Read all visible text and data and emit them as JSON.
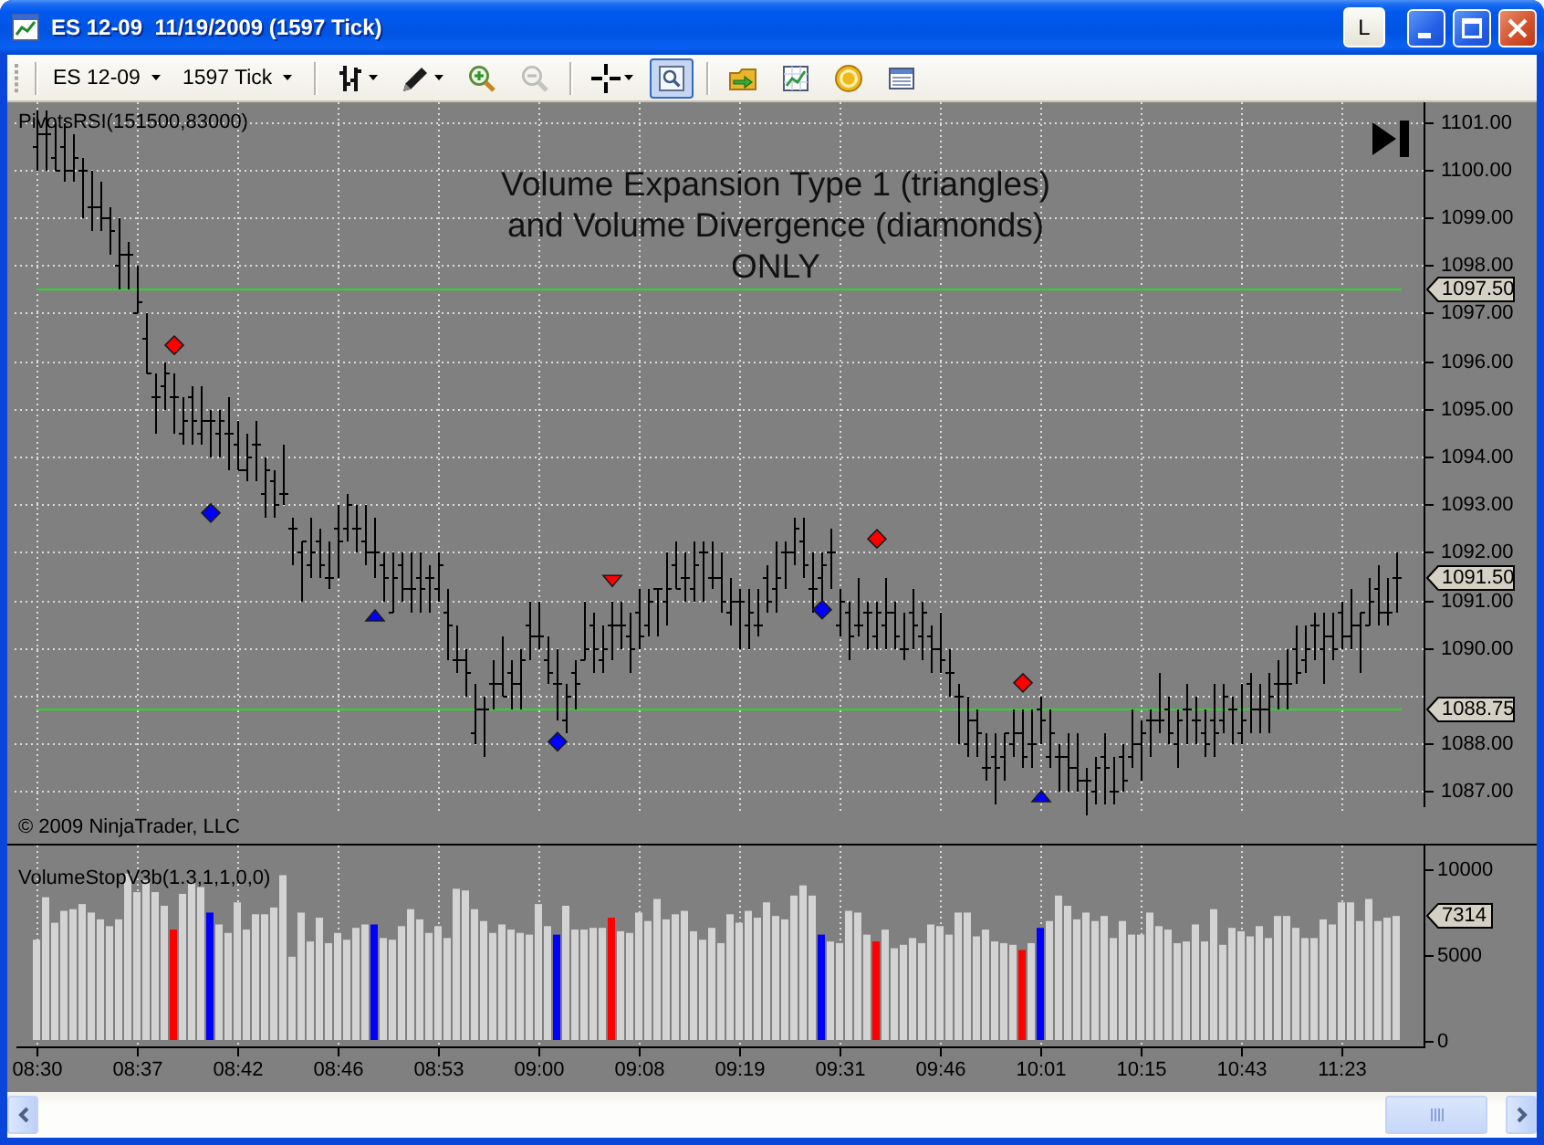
{
  "window": {
    "title": "ES 12-09  11/19/2009 (1597 Tick)",
    "layout_button": "L"
  },
  "toolbar": {
    "instrument": "ES 12-09",
    "interval": "1597 Tick",
    "tool_groups": [
      [
        {
          "kind": "price-bars",
          "dropdown": true,
          "disabled": false,
          "selected": false
        },
        {
          "kind": "pencil",
          "dropdown": true,
          "disabled": false,
          "selected": false
        },
        {
          "kind": "zoom-in",
          "dropdown": false,
          "disabled": false,
          "selected": false
        },
        {
          "kind": "zoom-out",
          "dropdown": false,
          "disabled": true,
          "selected": false
        }
      ],
      [
        {
          "kind": "crosshair",
          "dropdown": true,
          "disabled": false,
          "selected": false
        },
        {
          "kind": "magnifier-frame",
          "dropdown": false,
          "disabled": false,
          "selected": true
        }
      ],
      [
        {
          "kind": "folder-arrow",
          "dropdown": false,
          "disabled": false,
          "selected": false
        },
        {
          "kind": "line-chart",
          "dropdown": false,
          "disabled": false,
          "selected": false
        },
        {
          "kind": "coin",
          "dropdown": false,
          "disabled": false,
          "selected": false
        },
        {
          "kind": "table",
          "dropdown": false,
          "disabled": false,
          "selected": false
        }
      ]
    ]
  },
  "price_panel": {
    "indicator": "PivotsRSI(151500,83000)",
    "note": "Volume Expansion Type 1 (triangles)\nand Volume Divergence (diamonds)\nONLY",
    "y_ticks": [
      "1101.00",
      "1100.00",
      "1099.00",
      "1098.00",
      "1097.00",
      "1096.00",
      "1095.00",
      "1094.00",
      "1093.00",
      "1092.00",
      "1091.00",
      "1090.00",
      "1088.00",
      "1087.00"
    ],
    "price_tags": [
      {
        "label": "1097.50",
        "kind": "level"
      },
      {
        "label": "1091.50",
        "kind": "last"
      },
      {
        "label": "1088.75",
        "kind": "level"
      }
    ],
    "copyright": "© 2009 NinjaTrader, LLC"
  },
  "volume_panel": {
    "indicator": "VolumeStopV3b(1.3,1,1,0,0)",
    "last_value_tag": "7314",
    "time_labels": [
      "08:30",
      "08:37",
      "08:42",
      "08:46",
      "08:53",
      "09:00",
      "09:08",
      "09:19",
      "09:31",
      "09:46",
      "10:01",
      "10:15",
      "10:43",
      "11:23"
    ],
    "chart_data": {
      "type": "bar",
      "stacked": true,
      "ylim": [
        0,
        11500
      ],
      "yticks": [
        0,
        5000,
        10000
      ],
      "series": [
        {
          "color": "#d3d3d3",
          "values": [
            5900,
            8400,
            6900,
            7600,
            7700,
            8000,
            7500,
            7100,
            6700,
            7100,
            9800,
            8700,
            9400,
            8700,
            7900,
            null,
            8600,
            9300,
            9000,
            null,
            6800,
            6300,
            8100,
            6500,
            7400,
            7400,
            7800,
            9700,
            4900,
            7500,
            5800,
            7200,
            5700,
            6300,
            5900,
            6600,
            6800,
            null,
            6000,
            5900,
            6700,
            7700,
            7100,
            6300,
            6700,
            6000,
            8900,
            8800,
            7700,
            7000,
            6300,
            6800,
            6500,
            6300,
            6200,
            8000,
            6700,
            null,
            7900,
            6500,
            6500,
            6600,
            6600,
            null,
            6400,
            6300,
            7500,
            7000,
            8300,
            7100,
            7400,
            7600,
            6400,
            5900,
            6600,
            5700,
            7400,
            6900,
            7600,
            7200,
            8100,
            7300,
            7100,
            8500,
            9100,
            8500,
            null,
            5800,
            5700,
            7600,
            7500,
            6200,
            null,
            6500,
            5400,
            5600,
            6000,
            5700,
            6800,
            6700,
            6200,
            7500,
            7500,
            6100,
            6500,
            5800,
            5700,
            5600,
            null,
            5700,
            null,
            7000,
            8500,
            7900,
            7100,
            7500,
            7000,
            7300,
            6000,
            7000,
            6200,
            6200,
            7500,
            6700,
            6500,
            5700,
            5800,
            6800,
            5800,
            7700,
            5600,
            6600,
            6400,
            6100,
            6700,
            6000,
            7300,
            7300,
            6600,
            6000,
            6000,
            7100,
            6800,
            8100,
            8100,
            7000,
            8300,
            7000,
            7200,
            7300
          ]
        },
        {
          "color": "#ff0000",
          "values": [
            null,
            null,
            null,
            null,
            null,
            null,
            null,
            null,
            null,
            null,
            null,
            null,
            null,
            null,
            null,
            6500,
            null,
            null,
            null,
            null,
            null,
            null,
            null,
            null,
            null,
            null,
            null,
            null,
            null,
            null,
            null,
            null,
            null,
            null,
            null,
            null,
            null,
            null,
            null,
            null,
            null,
            null,
            null,
            null,
            null,
            null,
            null,
            null,
            null,
            null,
            null,
            null,
            null,
            null,
            null,
            null,
            null,
            null,
            null,
            null,
            null,
            null,
            null,
            7200,
            null,
            null,
            null,
            null,
            null,
            null,
            null,
            null,
            null,
            null,
            null,
            null,
            null,
            null,
            null,
            null,
            null,
            null,
            null,
            null,
            null,
            null,
            null,
            null,
            null,
            null,
            null,
            null,
            5800,
            null,
            null,
            null,
            null,
            null,
            null,
            null,
            null,
            null,
            null,
            null,
            null,
            null,
            null,
            null,
            5300,
            null,
            null,
            null,
            null,
            null,
            null,
            null,
            null,
            null,
            null,
            null,
            null,
            null,
            null,
            null,
            null,
            null,
            null,
            null,
            null,
            null,
            null,
            null,
            null,
            null,
            null,
            null,
            null,
            null,
            null,
            null,
            null,
            null,
            null,
            null,
            null,
            null,
            null,
            null,
            null,
            null
          ]
        },
        {
          "color": "#0000ff",
          "values": [
            null,
            null,
            null,
            null,
            null,
            null,
            null,
            null,
            null,
            null,
            null,
            null,
            null,
            null,
            null,
            null,
            null,
            null,
            null,
            7500,
            null,
            null,
            null,
            null,
            null,
            null,
            null,
            null,
            null,
            null,
            null,
            null,
            null,
            null,
            null,
            null,
            null,
            6800,
            null,
            null,
            null,
            null,
            null,
            null,
            null,
            null,
            null,
            null,
            null,
            null,
            null,
            null,
            null,
            null,
            null,
            null,
            null,
            6200,
            null,
            null,
            null,
            null,
            null,
            null,
            null,
            null,
            null,
            null,
            null,
            null,
            null,
            null,
            null,
            null,
            null,
            null,
            null,
            null,
            null,
            null,
            null,
            null,
            null,
            null,
            null,
            null,
            6200,
            null,
            null,
            null,
            null,
            null,
            null,
            null,
            null,
            null,
            null,
            null,
            null,
            null,
            null,
            null,
            null,
            null,
            null,
            null,
            null,
            null,
            null,
            null,
            6600,
            null,
            null,
            null,
            null,
            null,
            null,
            null,
            null,
            null,
            null,
            null,
            null,
            null,
            null,
            null,
            null,
            null,
            null,
            null,
            null,
            null,
            null,
            null,
            null,
            null,
            null,
            null,
            null,
            null,
            null,
            null,
            null,
            null,
            null,
            null,
            null,
            null,
            null,
            null
          ]
        }
      ]
    }
  }
}
